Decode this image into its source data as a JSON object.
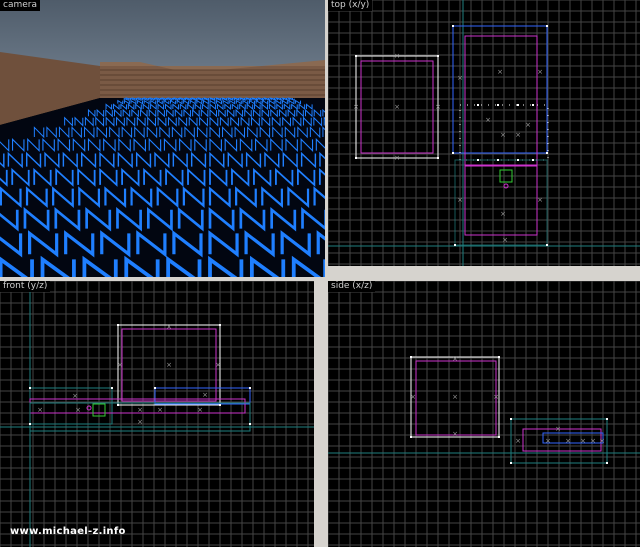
{
  "viewports": {
    "camera": {
      "label": "camera"
    },
    "top": {
      "label": "top (x/y)"
    },
    "front": {
      "label": "front (y/z)"
    },
    "side": {
      "label": "side (x/z)"
    }
  },
  "watermark": "www.michael-z.info",
  "colors": {
    "background": "#000000",
    "grid": "#4a4a4a",
    "axis": "#1f7f7f",
    "selected_brush": "#cc33cc",
    "brush_outline": "#ffffff",
    "blue_brush": "#3366ff",
    "floor_texture": "#1f7fff",
    "sky": "#5f6d7c",
    "wall": "#7a5a45",
    "entity": "#33cc33",
    "window_frame": "#d6d3ce"
  },
  "icons": {
    "scroll_left": "◂",
    "scroll_right": "▸",
    "scroll_up": "▴",
    "scroll_down": "▾"
  }
}
